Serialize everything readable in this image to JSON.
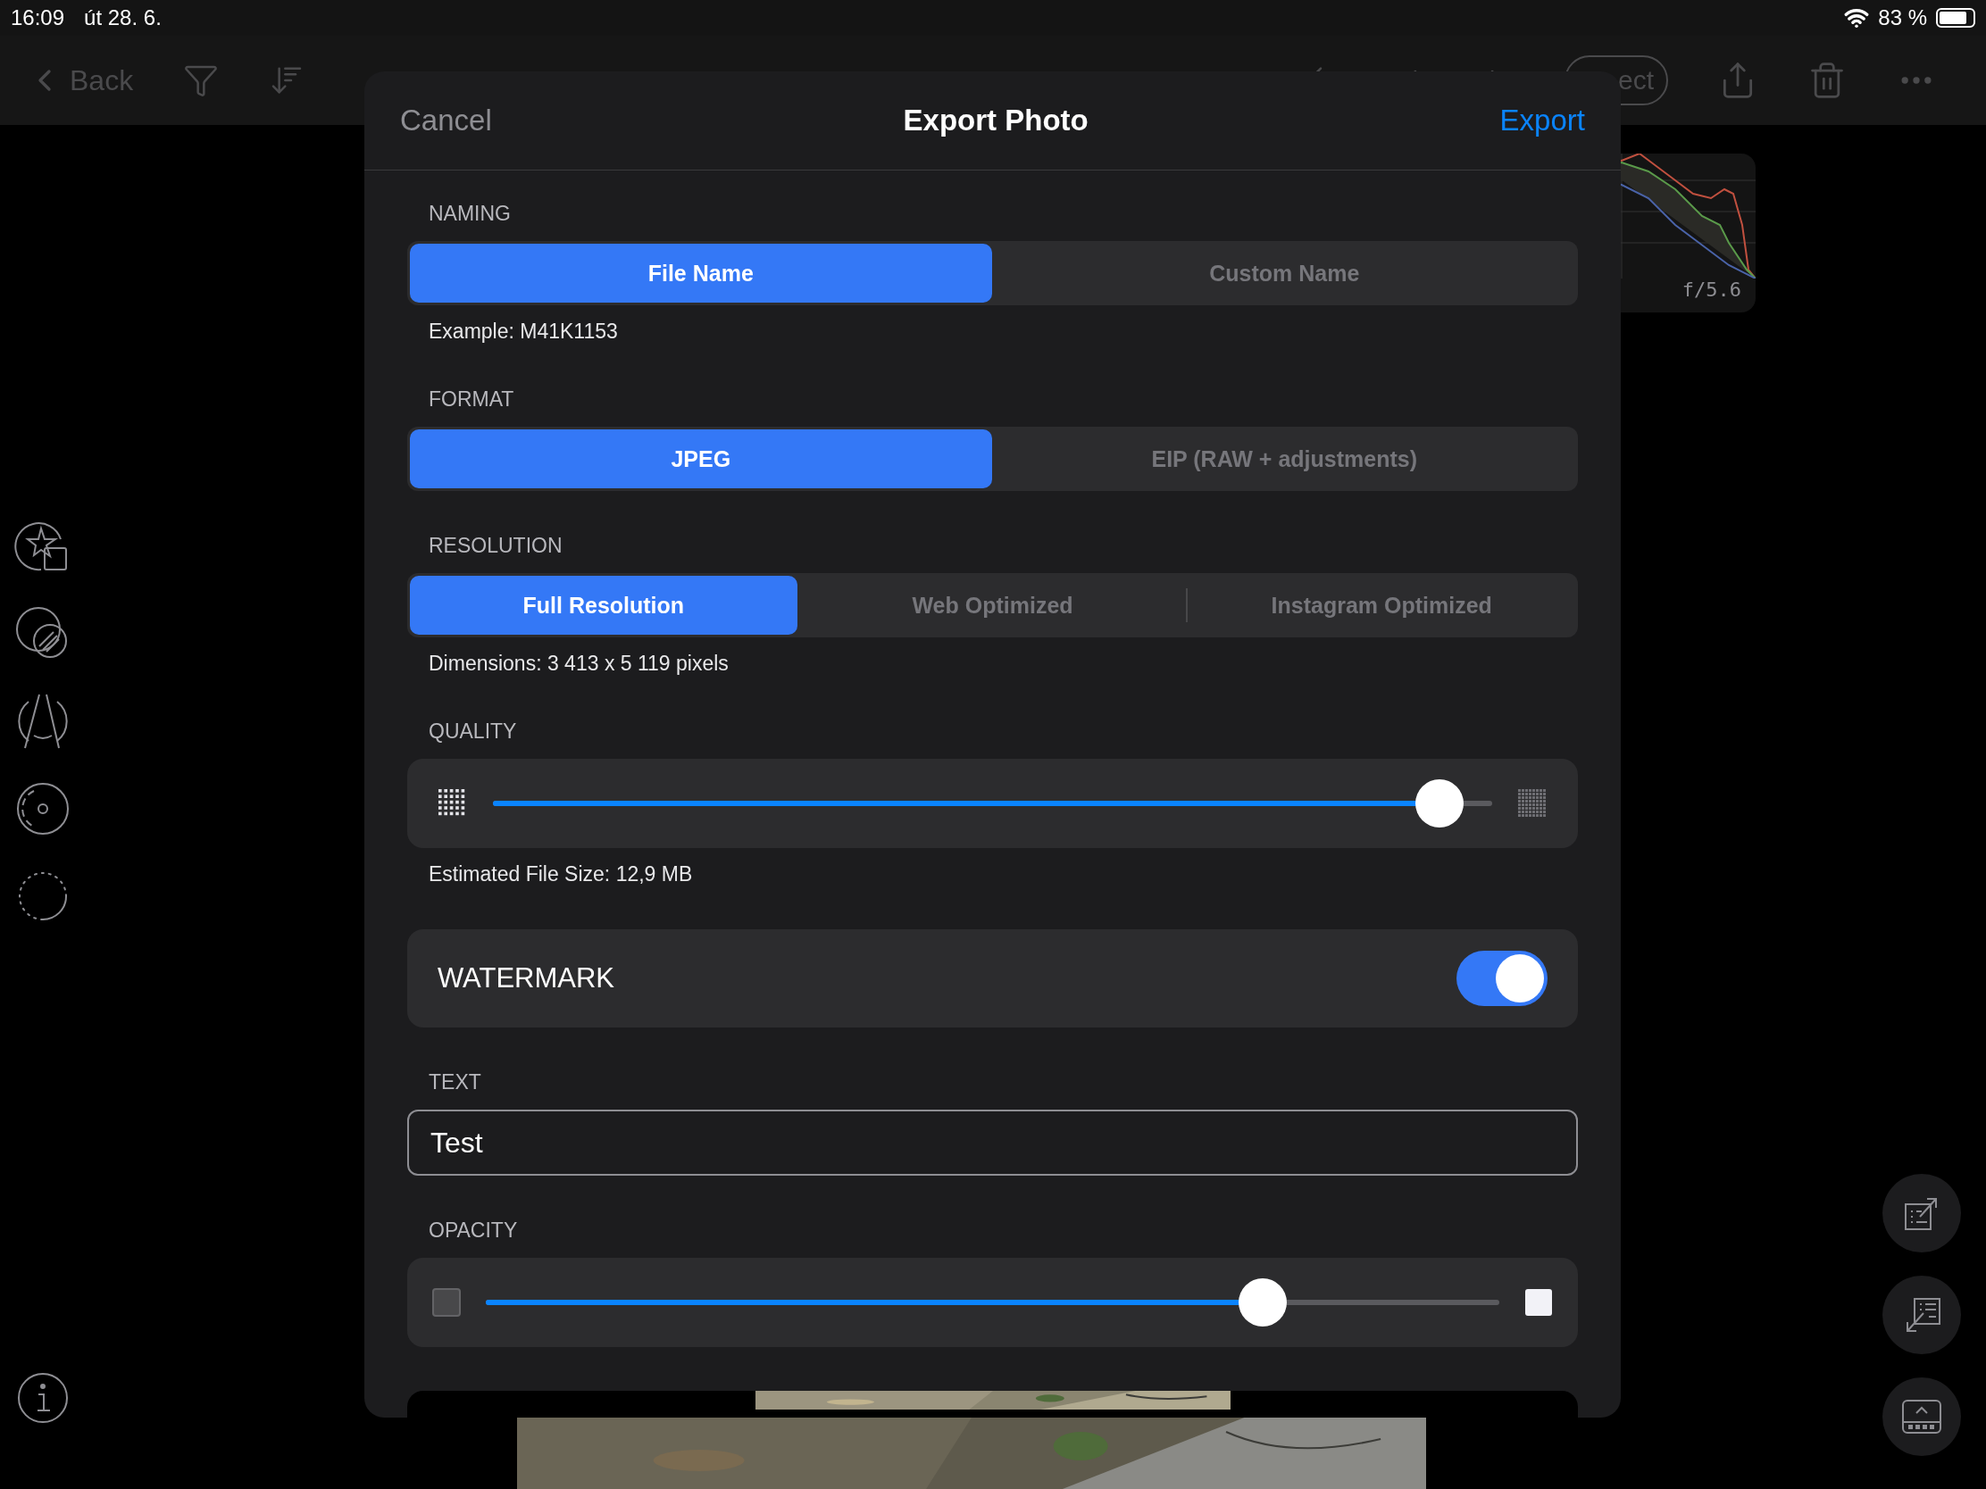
{
  "status_bar": {
    "time": "16:09",
    "date": "út 28. 6.",
    "battery": "83 %"
  },
  "toolbar": {
    "back": "Back",
    "select": "ect"
  },
  "histogram": {
    "aperture": "f/5.6"
  },
  "dialog": {
    "cancel": "Cancel",
    "title": "Export Photo",
    "export": "Export",
    "sections": [
      {
        "kind": "segmented",
        "label": "NAMING",
        "options": [
          {
            "label": "File Name",
            "selected": true
          },
          {
            "label": "Custom Name",
            "selected": false
          }
        ]
      },
      {
        "kind": "note",
        "text": "Example: M41K1153"
      },
      {
        "kind": "segmented",
        "label": "FORMAT",
        "options": [
          {
            "label": "JPEG",
            "selected": true
          },
          {
            "label": "EIP (RAW + adjustments)",
            "selected": false
          }
        ]
      },
      {
        "kind": "segmented",
        "label": "RESOLUTION",
        "options": [
          {
            "label": "Full Resolution",
            "selected": true
          },
          {
            "label": "Web Optimized",
            "selected": false
          },
          {
            "label": "Instagram Optimized",
            "selected": false
          }
        ]
      },
      {
        "kind": "note",
        "text": "Dimensions: 3 413 x 5 119 pixels"
      },
      {
        "kind": "quality",
        "label": "QUALITY",
        "level": 0.97
      },
      {
        "kind": "note",
        "text": "Estimated File Size: 12,9 MB"
      },
      {
        "kind": "toggle",
        "label": "WATERMARK",
        "on": true
      },
      {
        "kind": "text_field",
        "label": "TEXT",
        "value": "Test"
      },
      {
        "kind": "opacity",
        "label": "OPACITY",
        "level": 0.78
      },
      {
        "kind": "preview"
      }
    ]
  }
}
